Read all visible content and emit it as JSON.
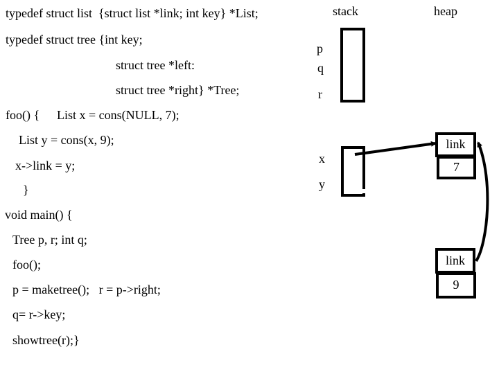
{
  "code": {
    "lines": [
      "typedef struct list  {struct list *link; int key} *List;",
      "typedef struct tree {int key;",
      "struct tree *left:",
      "struct tree *right} *Tree;",
      "foo() {",
      "List x = cons(NULL, 7);",
      "List y = cons(x, 9);",
      "x->link = y;",
      "}",
      "void main() {",
      "Tree p, r; int q;",
      "foo();",
      "p = maketree();   r = p->right;",
      "q= r->key;",
      "showtree(r);}"
    ]
  },
  "diagram": {
    "stack_title": "stack",
    "heap_title": "heap",
    "main_frame_vars": [
      "p",
      "q",
      "r"
    ],
    "foo_frame_vars": [
      "x",
      "y"
    ],
    "nodes": [
      {
        "link_label": "link",
        "key": "7"
      },
      {
        "link_label": "link",
        "key": "9"
      }
    ],
    "arrows": [
      {
        "from": "x",
        "to": "node-7"
      },
      {
        "from": "node-9.link",
        "to": "node-7"
      }
    ]
  }
}
